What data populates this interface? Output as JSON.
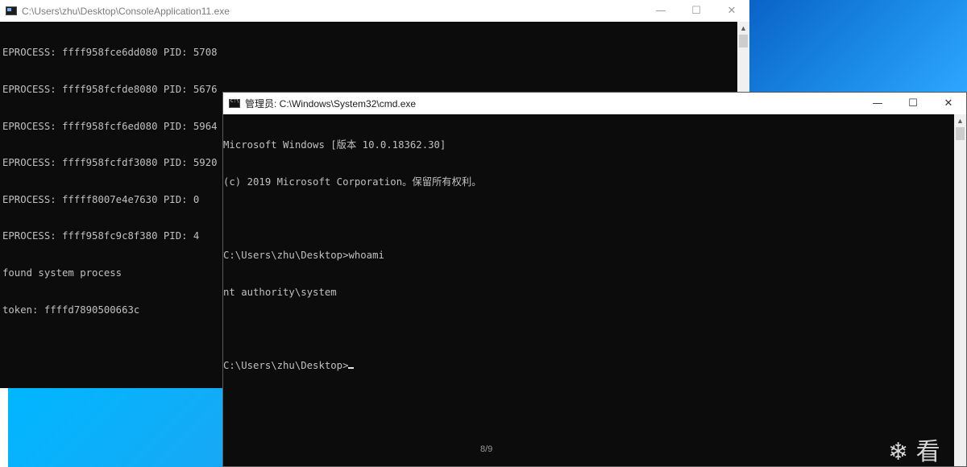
{
  "console_app_window": {
    "title": "C:\\Users\\zhu\\Desktop\\ConsoleApplication11.exe",
    "minimize": "—",
    "maximize": "☐",
    "close": "✕",
    "lines": [
      "EPROCESS: ffff958fce6dd080 PID: 5708",
      "EPROCESS: ffff958fcfde8080 PID: 5676",
      "EPROCESS: ffff958fcf6ed080 PID: 5964",
      "EPROCESS: ffff958fcfdf3080 PID: 5920",
      "EPROCESS: fffff8007e4e7630 PID: 0",
      "EPROCESS: ffff958fc9c8f380 PID: 4",
      "found system process",
      "token: ffffd7890500663c"
    ]
  },
  "cmd_window": {
    "title": "管理员: C:\\Windows\\System32\\cmd.exe",
    "minimize": "—",
    "maximize": "☐",
    "close": "✕",
    "lines": [
      "Microsoft Windows [版本 10.0.18362.30]",
      "(c) 2019 Microsoft Corporation。保留所有权利。",
      "",
      "C:\\Users\\zhu\\Desktop>whoami",
      "nt authority\\system",
      ""
    ],
    "prompt": "C:\\Users\\zhu\\Desktop>"
  },
  "page_counter": "8/9",
  "watermark": "❄ 看",
  "colors": {
    "console_bg": "#0c0c0c",
    "console_text": "#c0c0c0",
    "desktop_accent": "#1a8ae6",
    "desktop_cyan": "#00b7ff"
  }
}
